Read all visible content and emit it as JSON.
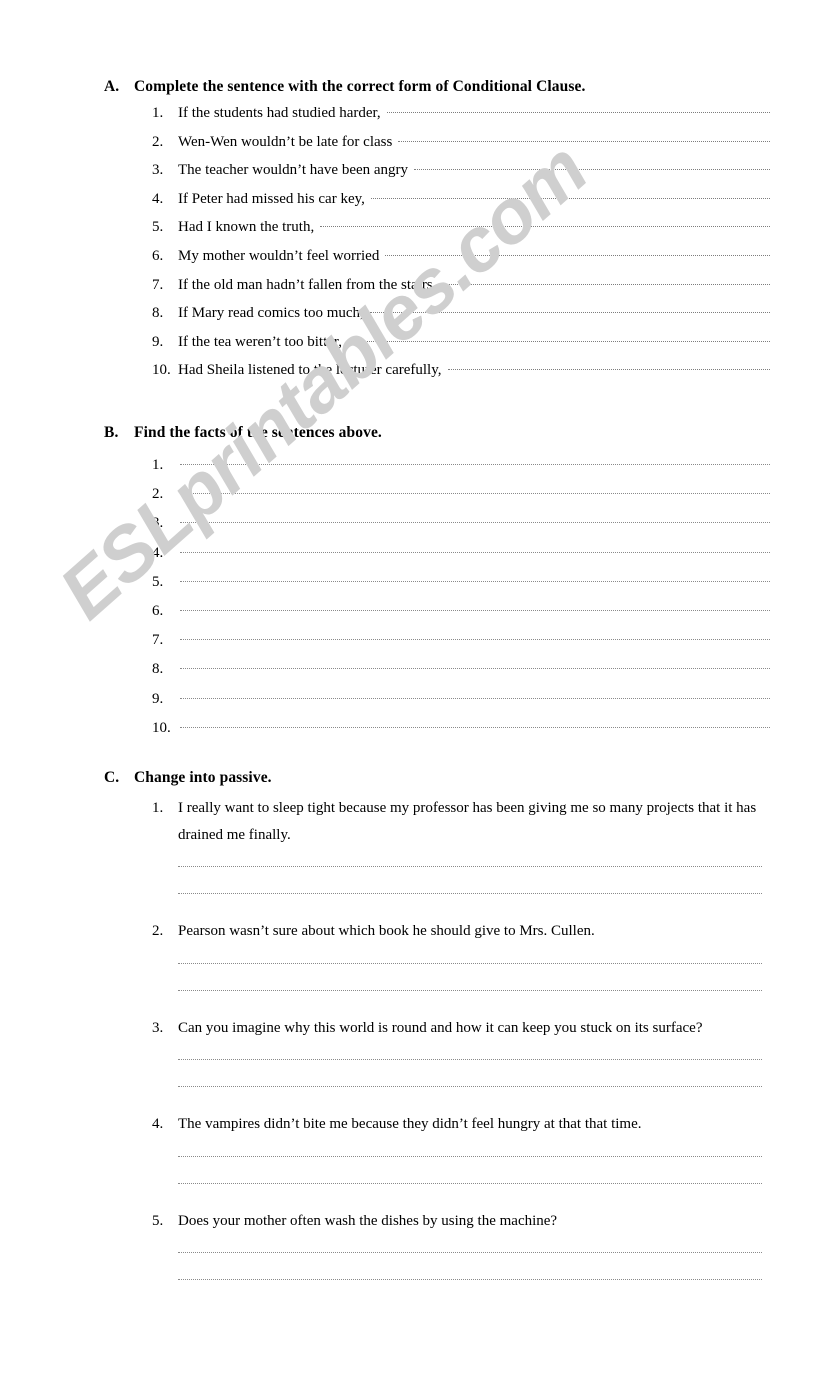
{
  "watermark": {
    "text": "ESLprintables.com",
    "color": "#cfcfcf"
  },
  "sections": [
    {
      "letter": "A.",
      "title": "Complete the sentence with the correct form of Conditional Clause.",
      "items": [
        {
          "num": "1.",
          "text": "If the students had studied harder,"
        },
        {
          "num": "2.",
          "text": "Wen-Wen wouldn’t be late for class"
        },
        {
          "num": "3.",
          "text": "The teacher wouldn’t have been angry"
        },
        {
          "num": "4.",
          "text": "If Peter had missed his car key,"
        },
        {
          "num": "5.",
          "text": "Had I known the truth,"
        },
        {
          "num": "6.",
          "text": "My mother wouldn’t feel worried"
        },
        {
          "num": "7.",
          "text": "If the old man hadn’t  fallen from the stairs,"
        },
        {
          "num": "8.",
          "text": "If Mary read comics too much,"
        },
        {
          "num": "9.",
          "text": "If the tea weren’t too bitter,"
        },
        {
          "num": "10.",
          "text": "Had Sheila listened to the lecturer carefully,"
        }
      ]
    },
    {
      "letter": "B.",
      "title": "Find the facts of the sentences above.",
      "items": [
        {
          "num": "1.",
          "text": ""
        },
        {
          "num": "2.",
          "text": ""
        },
        {
          "num": "3.",
          "text": ""
        },
        {
          "num": "4.",
          "text": ""
        },
        {
          "num": "5.",
          "text": ""
        },
        {
          "num": "6.",
          "text": ""
        },
        {
          "num": "7.",
          "text": ""
        },
        {
          "num": "8.",
          "text": ""
        },
        {
          "num": "9.",
          "text": ""
        },
        {
          "num": "10.",
          "text": ""
        }
      ]
    },
    {
      "letter": "C.",
      "title": "Change into passive.",
      "items": [
        {
          "num": "1.",
          "text": "I really want to sleep tight because my professor has been giving me so many projects that it has drained me finally.",
          "answer_lines": 2
        },
        {
          "num": "2.",
          "text": "Pearson wasn’t sure about which book he should give to Mrs. Cullen.",
          "answer_lines": 2
        },
        {
          "num": "3.",
          "text": "Can you imagine why this world is round and how it can keep you stuck on its surface?",
          "answer_lines": 2
        },
        {
          "num": "4.",
          "text": "The vampires didn’t bite me because they didn’t feel hungry at that that time.",
          "answer_lines": 2
        },
        {
          "num": "5.",
          "text": "Does your mother often wash the dishes by using the machine?",
          "answer_lines": 2
        }
      ]
    }
  ]
}
